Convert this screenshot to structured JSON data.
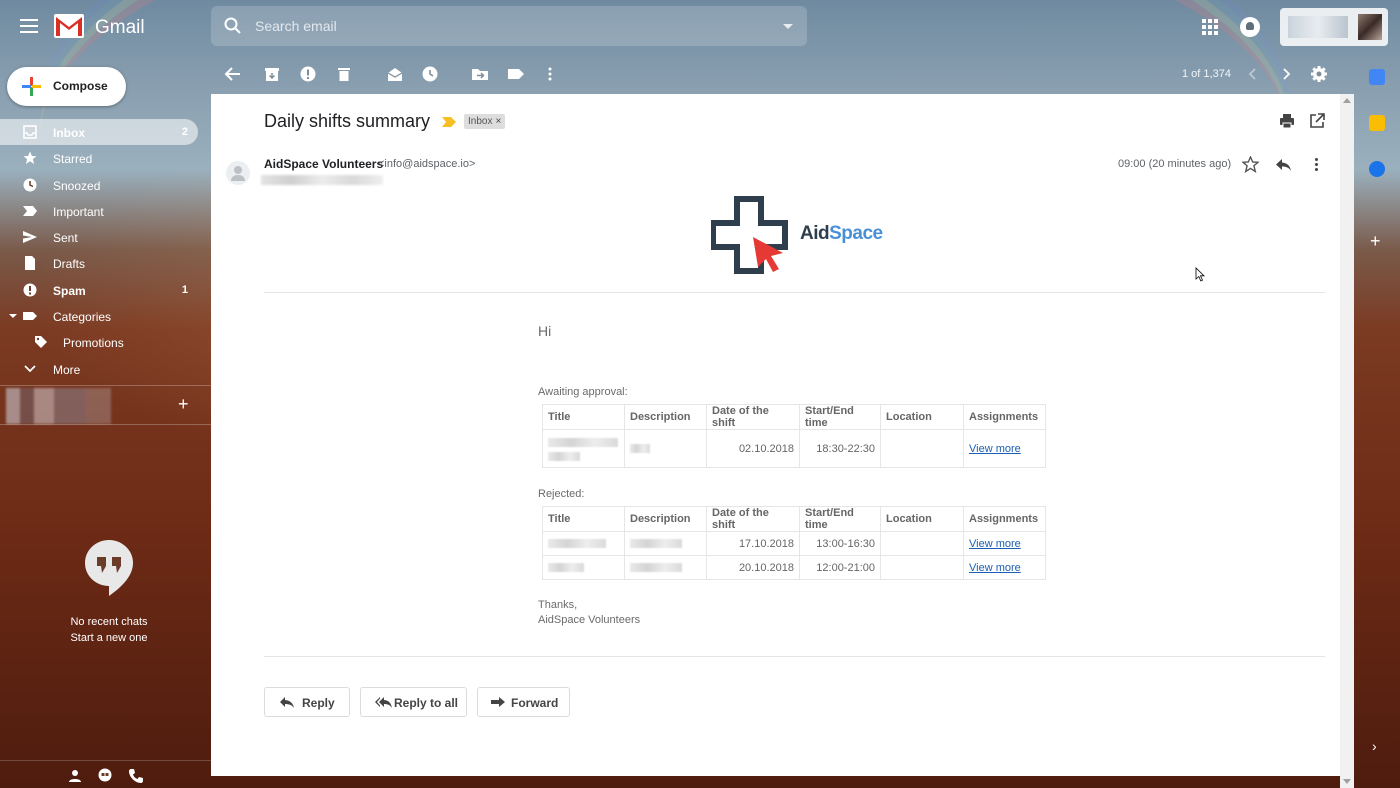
{
  "app": {
    "name": "Gmail"
  },
  "search": {
    "placeholder": "Search email"
  },
  "compose": {
    "label": "Compose"
  },
  "nav": {
    "items": [
      {
        "label": "Inbox",
        "count": "2",
        "icon": "inbox-icon"
      },
      {
        "label": "Starred",
        "count": "",
        "icon": "star-icon"
      },
      {
        "label": "Snoozed",
        "count": "",
        "icon": "clock-icon"
      },
      {
        "label": "Important",
        "count": "",
        "icon": "important-icon"
      },
      {
        "label": "Sent",
        "count": "",
        "icon": "send-icon"
      },
      {
        "label": "Drafts",
        "count": "",
        "icon": "draft-icon"
      },
      {
        "label": "Spam",
        "count": "1",
        "icon": "spam-icon"
      },
      {
        "label": "Categories",
        "count": "",
        "icon": "label-icon"
      },
      {
        "label": "Promotions",
        "count": "",
        "icon": "tag-icon"
      },
      {
        "label": "More",
        "count": "",
        "icon": "chevron-down-icon"
      }
    ]
  },
  "hangouts": {
    "no_chats": "No recent chats",
    "start_new": "Start a new one"
  },
  "toolbar": {
    "pager": "1 of 1,374"
  },
  "email": {
    "subject": "Daily shifts summary",
    "label_chip": "Inbox",
    "chip_close": "×",
    "sender_name": "AidSpace Volunteers",
    "sender_email": "<info@aidspace.io>",
    "time": "09:00 (20 minutes ago)",
    "logo": {
      "word_a": "Aid",
      "word_b": "Space"
    },
    "greeting": "Hi",
    "awaiting_label": "Awaiting approval:",
    "rejected_label": "Rejected:",
    "columns": [
      "Title",
      "Description",
      "Date of the shift",
      "Start/End time",
      "Location",
      "Assignments"
    ],
    "awaiting_rows": [
      {
        "date": "02.10.2018",
        "time": "18:30-22:30",
        "location": "",
        "link": "View more"
      }
    ],
    "rejected_rows": [
      {
        "date": "17.10.2018",
        "time": "13:00-16:30",
        "location": "",
        "link": "View more"
      },
      {
        "date": "20.10.2018",
        "time": "12:00-21:00",
        "location": "",
        "link": "View more"
      }
    ],
    "thanks": "Thanks,",
    "signoff": "AidSpace Volunteers"
  },
  "actions": {
    "reply": "Reply",
    "reply_all": "Reply to all",
    "forward": "Forward"
  },
  "colors": {
    "logo_dark": "#2f3e4d",
    "logo_blue": "#4a90d9",
    "cursor_red": "#e53935",
    "link": "#1a5fb4"
  }
}
